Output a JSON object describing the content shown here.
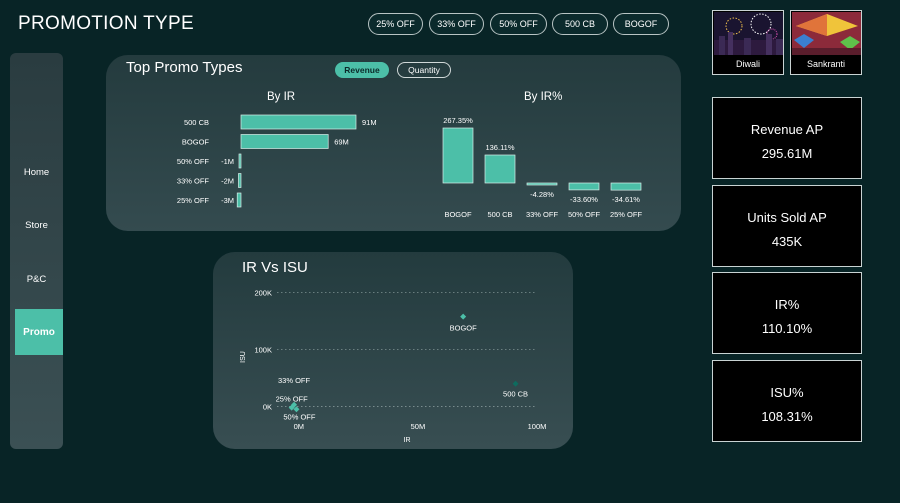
{
  "page_title": "PROMOTION TYPE",
  "filters": [
    "25% OFF",
    "33% OFF",
    "50% OFF",
    "500 CB",
    "BOGOF"
  ],
  "festivals": [
    {
      "label": "Diwali",
      "icon": "diwali-fireworks-image"
    },
    {
      "label": "Sankranti",
      "icon": "sankranti-kites-image"
    }
  ],
  "nav": {
    "items": [
      "Home",
      "Store",
      "P&C"
    ],
    "active": "Promo"
  },
  "top_card": {
    "title": "Top Promo Types",
    "toggle_revenue": "Revenue",
    "toggle_quantity": "Quantity",
    "by_ir_title": "By IR",
    "by_irpct_title": "By IR%"
  },
  "scatter_card": {
    "title": "IR Vs ISU"
  },
  "kpis": [
    {
      "label": "Revenue AP",
      "value": "295.61M"
    },
    {
      "label": "Units Sold AP",
      "value": "435K"
    },
    {
      "label": "IR%",
      "value": "110.10%"
    },
    {
      "label": "ISU%",
      "value": "108.31%"
    }
  ],
  "colors": {
    "accent": "#4cbfa8",
    "background": "#082426"
  },
  "chart_data": [
    {
      "type": "bar",
      "orientation": "horizontal",
      "title": "By IR",
      "categories": [
        "500 CB",
        "BOGOF",
        "50% OFF",
        "33% OFF",
        "25% OFF"
      ],
      "values": [
        91,
        69,
        -1,
        -2,
        -3
      ],
      "value_labels": [
        "91M",
        "69M",
        "-1M",
        "-2M",
        "-3M"
      ],
      "xlim": [
        -3,
        91
      ]
    },
    {
      "type": "bar",
      "title": "By IR%",
      "categories": [
        "BOGOF",
        "500 CB",
        "33% OFF",
        "50% OFF",
        "25% OFF"
      ],
      "values": [
        267.35,
        136.11,
        -4.28,
        -33.6,
        -34.61
      ],
      "value_labels": [
        "267.35%",
        "136.11%",
        "-4.28%",
        "-33.60%",
        "-34.61%"
      ],
      "ylim": [
        -40,
        270
      ]
    },
    {
      "type": "scatter",
      "title": "IR Vs ISU",
      "xlabel": "IR",
      "ylabel": "ISU",
      "xlim": [
        -10,
        100
      ],
      "ylim": [
        -15,
        210
      ],
      "x_ticks": [
        {
          "value": 0,
          "label": "0M"
        },
        {
          "value": 50,
          "label": "50M"
        },
        {
          "value": 100,
          "label": "100M"
        }
      ],
      "y_ticks": [
        {
          "value": 0,
          "label": "0K"
        },
        {
          "value": 100,
          "label": "100K"
        },
        {
          "value": 200,
          "label": "200K"
        }
      ],
      "points": [
        {
          "label": "BOGOF",
          "x": 69,
          "y": 158,
          "color": "#4cbfa8"
        },
        {
          "label": "500 CB",
          "x": 91,
          "y": 40,
          "color": "#0e6b5e"
        },
        {
          "label": "33% OFF",
          "x": -2,
          "y": 3,
          "color": "#4cbfa8"
        },
        {
          "label": "25% OFF",
          "x": -3,
          "y": -2,
          "color": "#4cbfa8"
        },
        {
          "label": "50% OFF",
          "x": -1,
          "y": -5,
          "color": "#4cbfa8"
        }
      ]
    }
  ]
}
